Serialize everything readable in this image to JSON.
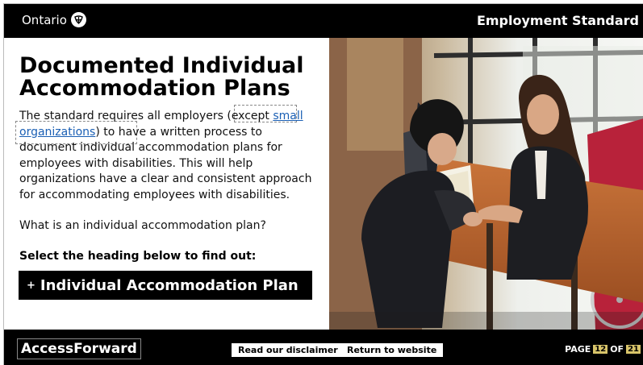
{
  "header": {
    "brand": "Ontario",
    "title": "Employment Standard"
  },
  "main": {
    "heading": "Documented Individual Accommodation Plans",
    "intro_before": "The standard requires all employers (except ",
    "intro_link": "small organizations",
    "intro_after": ") to have a written process to document individual accommodation plans for employees with disabilities. This will help organizations have a clear and consistent approach for accommodating employees with disabilities.",
    "question": "What is an individual accommodation plan?",
    "select_prompt": "Select the heading below to find out:",
    "accordion_label": "Individual Accommodation Plan",
    "accordion_symbol": "+"
  },
  "footer": {
    "logo": "AccessForward",
    "disclaimer_button": "Read our disclaimer",
    "return_button": "Return to website",
    "page_label": "PAGE",
    "page_current": "12",
    "page_of": "OF",
    "page_total": "21"
  }
}
